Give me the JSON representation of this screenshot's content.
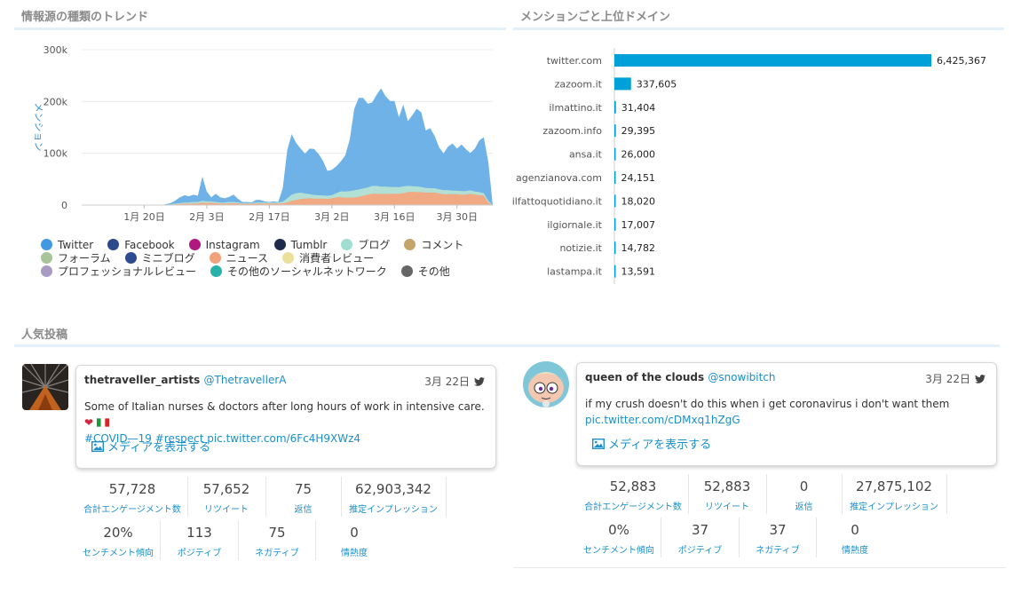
{
  "sections": {
    "trend_title": "情報源の種類のトレンド",
    "domains_title": "メンションごと上位ドメイン",
    "posts_title": "人気投稿"
  },
  "chart_data": [
    {
      "type": "area",
      "title": "情報源の種類のトレンド",
      "ylabel": "メンション",
      "ylim": [
        0,
        300000
      ],
      "yticks": [
        "0",
        "100k",
        "200k",
        "300k"
      ],
      "xticks": [
        "1月 20日",
        "2月 3日",
        "2月 17日",
        "3月 2日",
        "3月 16日",
        "3月 30日"
      ],
      "x": [
        "1/6",
        "1/7",
        "1/8",
        "1/9",
        "1/10",
        "1/11",
        "1/12",
        "1/13",
        "1/14",
        "1/15",
        "1/16",
        "1/17",
        "1/18",
        "1/19",
        "1/20",
        "1/21",
        "1/22",
        "1/23",
        "1/24",
        "1/25",
        "1/26",
        "1/27",
        "1/28",
        "1/29",
        "1/30",
        "1/31",
        "2/1",
        "2/2",
        "2/3",
        "2/4",
        "2/5",
        "2/6",
        "2/7",
        "2/8",
        "2/9",
        "2/10",
        "2/11",
        "2/12",
        "2/13",
        "2/14",
        "2/15",
        "2/16",
        "2/17",
        "2/18",
        "2/19",
        "2/20",
        "2/21",
        "2/22",
        "2/23",
        "2/24",
        "2/25",
        "2/26",
        "2/27",
        "2/28",
        "2/29",
        "3/1",
        "3/2",
        "3/3",
        "3/4",
        "3/5",
        "3/6",
        "3/7",
        "3/8",
        "3/9",
        "3/10",
        "3/11",
        "3/12",
        "3/13",
        "3/14",
        "3/15",
        "3/16",
        "3/17",
        "3/18",
        "3/19",
        "3/20",
        "3/21",
        "3/22",
        "3/23",
        "3/24",
        "3/25",
        "3/26",
        "3/27",
        "3/28",
        "3/29",
        "3/30",
        "3/31",
        "4/1",
        "4/2",
        "4/3",
        "4/4",
        "4/5",
        "4/6",
        "4/7"
      ],
      "series": [
        {
          "name": "ニュース",
          "color": "#f0a982",
          "values": [
            0,
            0,
            0,
            0,
            0,
            0,
            0,
            0,
            0,
            0,
            0,
            0,
            0,
            0,
            0,
            0,
            0,
            0,
            0,
            500,
            800,
            1500,
            2000,
            2500,
            2500,
            3000,
            3000,
            4500,
            4000,
            4500,
            3500,
            3000,
            3000,
            3500,
            3500,
            3000,
            2500,
            2500,
            2500,
            3000,
            3000,
            3000,
            3000,
            3000,
            3000,
            3500,
            5000,
            8000,
            10000,
            12000,
            12500,
            13000,
            12500,
            12500,
            12500,
            12000,
            13000,
            15000,
            15500,
            14000,
            14500,
            14500,
            16000,
            18000,
            20000,
            22000,
            22000,
            21500,
            21500,
            22000,
            22000,
            22000,
            23000,
            25000,
            25500,
            25000,
            25000,
            24000,
            24000,
            24500,
            22500,
            21000,
            21000,
            21000,
            21000,
            20000,
            20000,
            22000,
            20000,
            19000,
            18000,
            5000,
            0
          ]
        },
        {
          "name": "ブログ",
          "color": "#b2e0d4",
          "values": [
            0,
            0,
            0,
            0,
            0,
            0,
            0,
            0,
            0,
            0,
            0,
            0,
            0,
            0,
            0,
            0,
            0,
            0,
            0,
            500,
            800,
            1500,
            2000,
            2500,
            2500,
            3000,
            3000,
            3500,
            3000,
            2500,
            2500,
            2000,
            2000,
            2500,
            2500,
            2000,
            1500,
            1500,
            1500,
            2000,
            2000,
            2000,
            2000,
            2000,
            2000,
            3000,
            8000,
            12000,
            13000,
            12000,
            10000,
            8000,
            7000,
            6500,
            6000,
            6000,
            6000,
            8000,
            11000,
            12000,
            12500,
            14000,
            14000,
            14000,
            14000,
            15000,
            15000,
            14000,
            14000,
            13000,
            13000,
            12500,
            13000,
            12000,
            11000,
            11000,
            10000,
            9000,
            8500,
            8000,
            8000,
            8000,
            8000,
            7000,
            7000,
            7000,
            7000,
            6500,
            6000,
            6000,
            5000,
            3000,
            0
          ]
        },
        {
          "name": "Twitter",
          "color": "#6eb2e8",
          "values": [
            0,
            0,
            0,
            0,
            0,
            0,
            0,
            0,
            0,
            0,
            0,
            0,
            0,
            0,
            0,
            0,
            0,
            0,
            0,
            1000,
            2500,
            6000,
            11000,
            14000,
            12000,
            14000,
            12000,
            47000,
            19000,
            8000,
            16000,
            10000,
            8000,
            10000,
            14000,
            7000,
            2000,
            2000,
            1000,
            5000,
            5000,
            2000,
            1000,
            2000,
            1000,
            26000,
            93000,
            117000,
            97000,
            85000,
            77000,
            88000,
            89000,
            80000,
            67000,
            48000,
            49000,
            52000,
            58000,
            70000,
            100000,
            157000,
            177000,
            175000,
            162000,
            161000,
            176000,
            190000,
            175000,
            166000,
            166000,
            135000,
            158000,
            125000,
            137000,
            150000,
            144000,
            111000,
            116000,
            101000,
            81000,
            71000,
            84000,
            91000,
            81000,
            90000,
            81000,
            72000,
            83000,
            100000,
            108000,
            75000,
            0
          ]
        }
      ]
    },
    {
      "type": "bar",
      "title": "メンションごと上位ドメイン",
      "orientation": "horizontal",
      "color": "#00a0d8",
      "categories": [
        "twitter.com",
        "zazoom.it",
        "ilmattino.it",
        "zazoom.info",
        "ansa.it",
        "agenzianova.com",
        "ilfattoquotidiano.it",
        "ilgiornale.it",
        "notizie.it",
        "lastampa.it"
      ],
      "values": [
        6425367,
        337605,
        31404,
        29395,
        26000,
        24151,
        18020,
        17007,
        14782,
        13591
      ],
      "labels": [
        "6,425,367",
        "337,605",
        "31,404",
        "29,395",
        "26,000",
        "24,151",
        "18,020",
        "17,007",
        "14,782",
        "13,591"
      ]
    }
  ],
  "legend": [
    [
      {
        "label": "Twitter",
        "color": "#4299e1"
      },
      {
        "label": "Facebook",
        "color": "#2b4a8b"
      },
      {
        "label": "Instagram",
        "color": "#b0177f"
      },
      {
        "label": "Tumblr",
        "color": "#1c2b4a"
      },
      {
        "label": "ブログ",
        "color": "#9fded0"
      },
      {
        "label": "コメント",
        "color": "#c5a46a"
      }
    ],
    [
      {
        "label": "フォーラム",
        "color": "#a9c49a"
      },
      {
        "label": "ミニブログ",
        "color": "#2d4c8f"
      },
      {
        "label": "ニュース",
        "color": "#f0a37a"
      },
      {
        "label": "消費者レビュー",
        "color": "#ecdf9a"
      }
    ],
    [
      {
        "label": "プロフェッショナルレビュー",
        "color": "#a99bc4"
      },
      {
        "label": "その他のソーシャルネットワーク",
        "color": "#28b1ab"
      },
      {
        "label": "その他",
        "color": "#666666"
      }
    ]
  ],
  "posts": [
    {
      "author": "thetraveller_artists",
      "handle": "@ThetravellerA",
      "date": "3月 22日",
      "text": "Some of Italian nurses & doctors after long hours of work in intensive care.",
      "emoji_heart": "❤",
      "tags": "#COVID—19 #respect",
      "link": "pic.twitter.com/6Fc4H9XWz4",
      "media_label": "メディアを表示する",
      "stats_row1": [
        {
          "value": "57,728",
          "label": "合計エンゲージメント数"
        },
        {
          "value": "57,652",
          "label": "リツイート"
        },
        {
          "value": "75",
          "label": "返信"
        },
        {
          "value": "62,903,342",
          "label": "推定インプレッション"
        }
      ],
      "stats_row2": [
        {
          "value": "20%",
          "label": "センチメント傾向"
        },
        {
          "value": "113",
          "label": "ポジティブ"
        },
        {
          "value": "75",
          "label": "ネガティブ"
        },
        {
          "value": "0",
          "label": "情熱度"
        }
      ]
    },
    {
      "author": "queen of the clouds",
      "handle": "@snowibitch",
      "date": "3月 22日",
      "text": "if my crush doesn't do this when i get coronavirus i don't want them",
      "link": "pic.twitter.com/cDMxq1hZgG",
      "media_label": "メディアを表示する",
      "stats_row1": [
        {
          "value": "52,883",
          "label": "合計エンゲージメント数"
        },
        {
          "value": "52,883",
          "label": "リツイート"
        },
        {
          "value": "0",
          "label": "返信"
        },
        {
          "value": "27,875,102",
          "label": "推定インプレッション"
        }
      ],
      "stats_row2": [
        {
          "value": "0%",
          "label": "センチメント傾向"
        },
        {
          "value": "37",
          "label": "ポジティブ"
        },
        {
          "value": "37",
          "label": "ネガティブ"
        },
        {
          "value": "0",
          "label": "情熱度"
        }
      ]
    }
  ]
}
